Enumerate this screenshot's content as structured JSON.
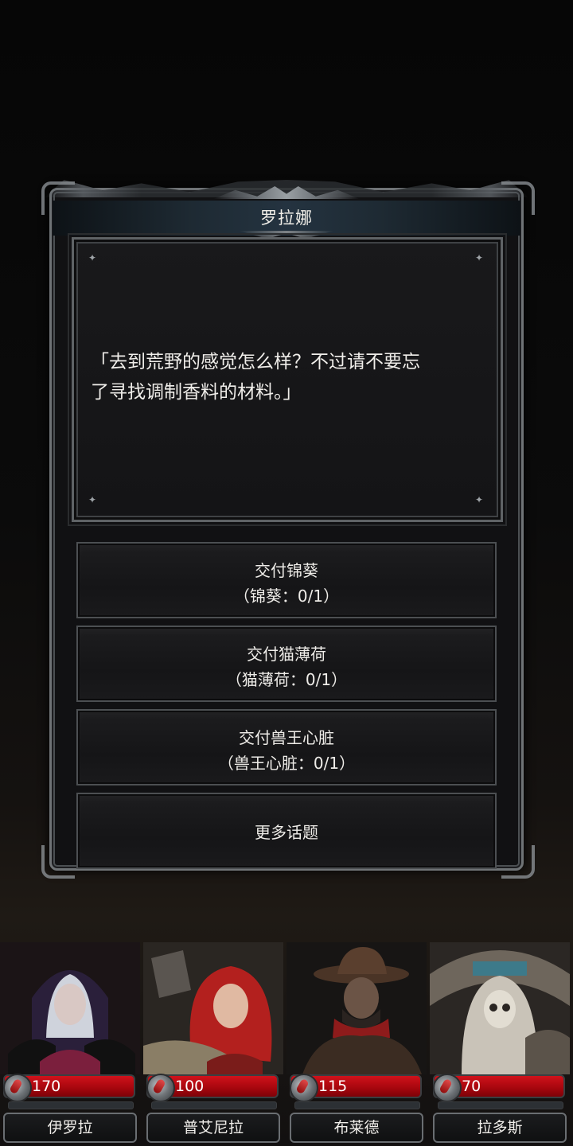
{
  "dialog": {
    "speaker": "罗拉娜",
    "speech_line1": "「去到荒野的感觉怎么样？不过请不要忘",
    "speech_line2": "了寻找调制香料的材料。」"
  },
  "options": [
    {
      "title": "交付锦葵",
      "detail": "（锦葵：0/1）"
    },
    {
      "title": "交付猫薄荷",
      "detail": "（猫薄荷：0/1）"
    },
    {
      "title": "交付兽王心脏",
      "detail": "（兽王心脏：0/1）"
    },
    {
      "title": "更多话题"
    }
  ],
  "party": [
    {
      "name": "伊罗拉",
      "hp": "170",
      "icon": "health-potion-icon"
    },
    {
      "name": "普艾尼拉",
      "hp": "100",
      "icon": "health-potion-icon"
    },
    {
      "name": "布莱德",
      "hp": "115",
      "icon": "health-potion-icon"
    },
    {
      "name": "拉多斯",
      "hp": "70",
      "icon": "health-potion-icon"
    }
  ],
  "colors": {
    "hp_red": "#c20c14",
    "frame": "#6f7376",
    "panel": "#151517"
  }
}
